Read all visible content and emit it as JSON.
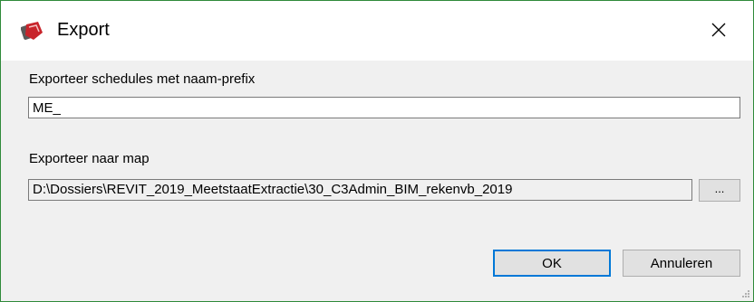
{
  "window": {
    "title": "Export",
    "app_icon": "revit-export-icon",
    "close_icon": "close-icon"
  },
  "prefix_section": {
    "label": "Exporteer schedules met naam-prefix",
    "value": "ME_"
  },
  "folder_section": {
    "label": "Exporteer naar map",
    "path": "D:\\Dossiers\\REVIT_2019_MeetstaatExtractie\\30_C3Admin_BIM_rekenvb_2019",
    "browse_label": "..."
  },
  "buttons": {
    "ok_label": "OK",
    "cancel_label": "Annuleren"
  },
  "colors": {
    "window_border": "#2f8a3a",
    "client_background": "#f0f0f0",
    "default_button_border": "#0078d7",
    "app_icon_red": "#c8242b"
  }
}
